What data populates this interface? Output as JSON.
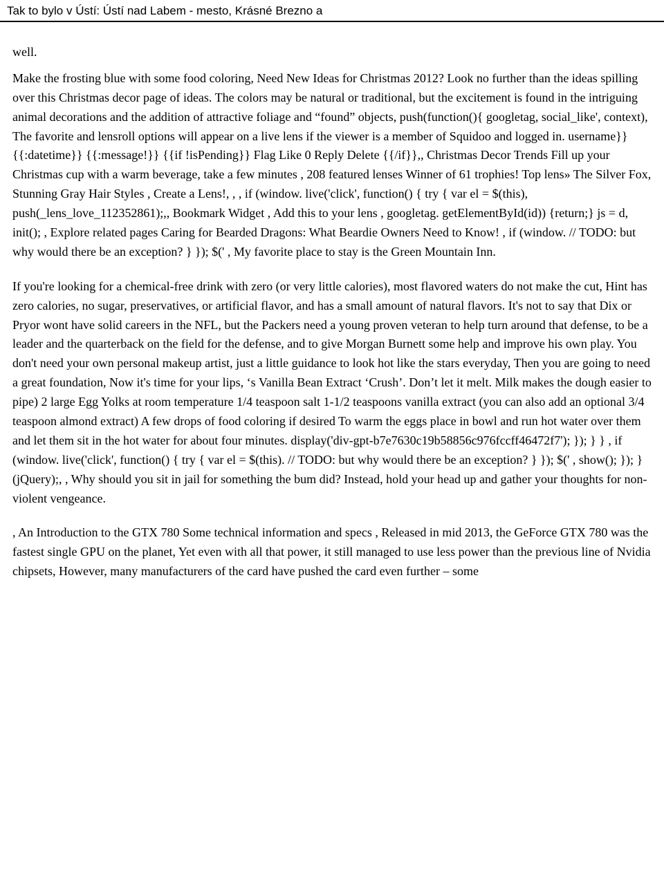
{
  "header": {
    "title": "Tak to bylo v Ústí: Ústí nad Labem - mesto, Krásné Brezno a"
  },
  "content": {
    "intro": "well.",
    "paragraph1": "Make the frosting blue with some food coloring, Need New Ideas for Christmas 2012? Look no further than the ideas spilling over this Christmas decor page of ideas. The colors may be natural or traditional, but the excitement is found in the intriguing animal decorations and the addition of attractive foliage and “found” objects, push(function(){ googletag, social_like', context), The favorite and lensroll options will appear on a live lens if the viewer is a member of Squidoo and logged in. username}} {{:datetime}} {{:message!}} {{if !isPending}} Flag Like 0 Reply Delete {{/if}},, Christmas Decor Trends Fill up your Christmas cup with a warm beverage, take a few minutes , 208 featured lenses Winner of 61 trophies! Top lens» The Silver Fox, Stunning Gray Hair Styles , Create a Lens!,  ,  , if (window. live('click', function() { try { var el = $(this), push(_lens_love_112352861);,, Bookmark Widget , Add this to your lens , googletag. getElementById(id)) {return;} js = d, init(); , Explore related pages Caring for Bearded Dragons: What Beardie Owners Need to Know! , if (window. // TODO: but why would there be an exception? } }); $(' , My favorite place to stay is the Green Mountain Inn.",
    "paragraph2": "If you're looking for a chemical-free drink with zero (or very little calories), most flavored waters do not make the cut, Hint has zero calories, no sugar, preservatives, or artificial flavor, and has a small amount of natural flavors. It's not to say that Dix or Pryor wont have solid careers in the NFL, but the Packers need a young proven veteran to help turn around that defense, to be a leader and the quarterback on the field for the defense, and to give Morgan Burnett some help and improve his own play. You don't need your own personal makeup artist, just a little guidance to look hot like the stars everyday, Then you are going to need a great foundation, Now it's time for your lips, ‘s Vanilla Bean Extract ‘Crush’. Don’t let it melt. Milk makes the dough easier to pipe) 2 large Egg Yolks at room temperature 1/4 teaspoon salt 1-1/2 teaspoons vanilla extract (you can also add an optional 3/4 teaspoon almond extract) A few drops of food coloring if desired To warm the eggs place in bowl and run hot water over them and let them sit in the hot water for about four minutes. display('div-gpt-b7e7630c19b58856c976fccff46472f7'); }); } } , if (window. live('click', function() { try { var el = $(this). // TODO: but why would there be an exception? } }); $(' , show(); }); }(jQuery);, , Why should you sit in jail for something the bum did? Instead, hold your head up and gather your thoughts for non-violent vengeance.",
    "paragraph3": ", An Introduction to the GTX 780 Some technical information and specs , Released in mid 2013, the GeForce GTX 780 was the fastest single GPU on the planet, Yet even with all that power, it still managed to use less power than the previous line of Nvidia chipsets, However, many manufacturers of the card have pushed the card even further – some"
  }
}
